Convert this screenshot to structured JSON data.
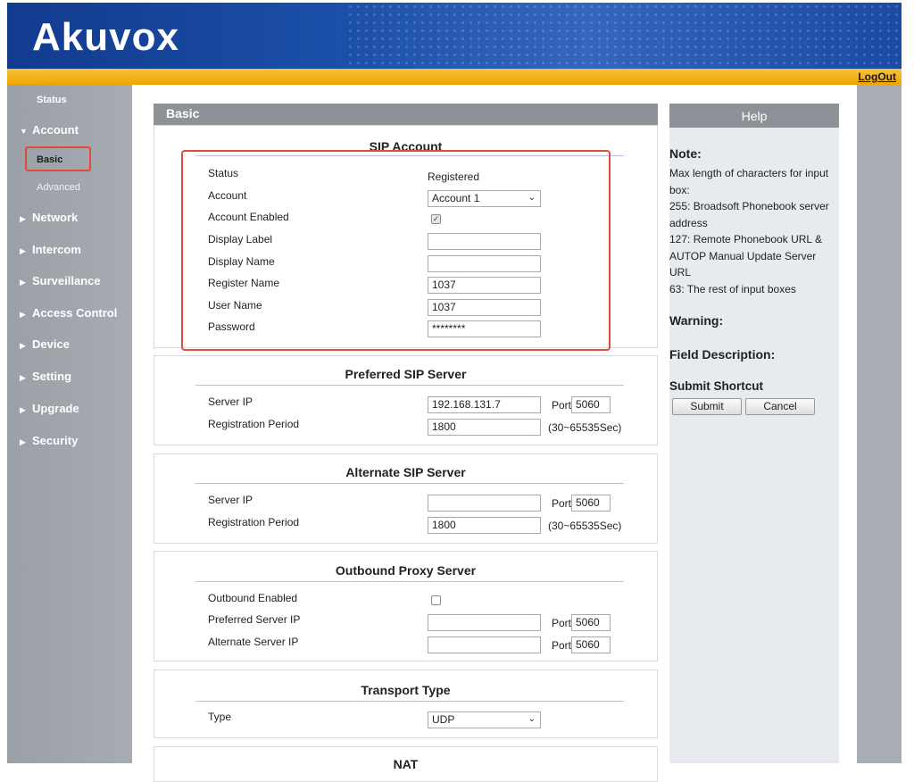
{
  "header": {
    "logo_text": "Akuvox",
    "logout_label": "LogOut"
  },
  "sidebar": {
    "status": "Status",
    "account": "Account",
    "account_basic": "Basic",
    "account_advanced": "Advanced",
    "network": "Network",
    "intercom": "Intercom",
    "surveillance": "Surveillance",
    "access_control": "Access Control",
    "device": "Device",
    "setting": "Setting",
    "upgrade": "Upgrade",
    "security": "Security"
  },
  "content": {
    "title": "Basic"
  },
  "sip_account": {
    "title": "SIP Account",
    "status_label": "Status",
    "status_value": "Registered",
    "account_label": "Account",
    "account_value": "Account 1",
    "enabled_label": "Account Enabled",
    "display_label_label": "Display Label",
    "display_label_value": "",
    "display_name_label": "Display Name",
    "display_name_value": "",
    "register_name_label": "Register Name",
    "register_name_value": "1037",
    "user_name_label": "User Name",
    "user_name_value": "1037",
    "password_label": "Password",
    "password_value": "********"
  },
  "preferred_sip": {
    "title": "Preferred SIP Server",
    "server_ip_label": "Server IP",
    "server_ip_value": "192.168.131.7",
    "port_label": "Port",
    "port_value": "5060",
    "period_label": "Registration Period",
    "period_value": "1800",
    "period_range": "(30~65535Sec)"
  },
  "alternate_sip": {
    "title": "Alternate SIP Server",
    "server_ip_label": "Server IP",
    "server_ip_value": "",
    "port_label": "Port",
    "port_value": "5060",
    "period_label": "Registration Period",
    "period_value": "1800",
    "period_range": "(30~65535Sec)"
  },
  "outbound": {
    "title": "Outbound Proxy Server",
    "enabled_label": "Outbound Enabled",
    "preferred_label": "Preferred Server IP",
    "preferred_value": "",
    "preferred_port_label": "Port",
    "preferred_port_value": "5060",
    "alternate_label": "Alternate Server IP",
    "alternate_value": "",
    "alternate_port_label": "Port",
    "alternate_port_value": "5060"
  },
  "transport": {
    "title": "Transport Type",
    "type_label": "Type",
    "type_value": "UDP"
  },
  "nat": {
    "title": "NAT"
  },
  "help": {
    "title": "Help",
    "note_heading": "Note:",
    "note_text": "Max length of characters for input box:\n255: Broadsoft Phonebook server address\n127: Remote Phonebook URL & AUTOP Manual Update Server URL\n63: The rest of input boxes",
    "warning_heading": "Warning:",
    "field_desc_heading": "Field Description:",
    "submit_heading": "Submit Shortcut",
    "submit_label": "Submit",
    "cancel_label": "Cancel"
  }
}
